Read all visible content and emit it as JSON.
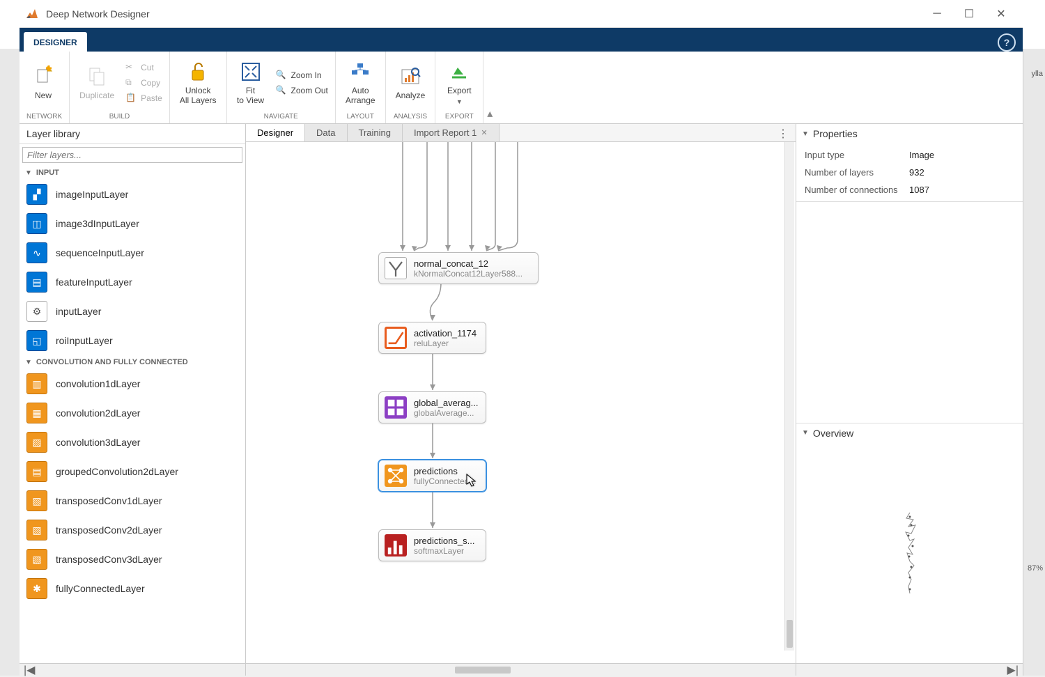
{
  "window": {
    "title": "Deep Network Designer"
  },
  "ribbonTab": "DESIGNER",
  "ribbon": {
    "network": {
      "label": "NETWORK",
      "new": "New"
    },
    "build": {
      "label": "BUILD",
      "duplicate": "Duplicate",
      "cut": "Cut",
      "copy": "Copy",
      "paste": "Paste"
    },
    "unlock": "Unlock\nAll Layers",
    "navigate": {
      "label": "NAVIGATE",
      "fit": "Fit\nto View",
      "zoomin": "Zoom In",
      "zoomout": "Zoom Out"
    },
    "layout": {
      "label": "LAYOUT",
      "auto": "Auto\nArrange"
    },
    "analysis": {
      "label": "ANALYSIS",
      "analyze": "Analyze"
    },
    "export": {
      "label": "EXPORT",
      "export": "Export"
    }
  },
  "sidebar": {
    "title": "Layer library",
    "filter_placeholder": "Filter layers...",
    "cat_input": "INPUT",
    "cat_conv": "CONVOLUTION AND FULLY CONNECTED",
    "layers_input": [
      "imageInputLayer",
      "image3dInputLayer",
      "sequenceInputLayer",
      "featureInputLayer",
      "inputLayer",
      "roiInputLayer"
    ],
    "layers_conv": [
      "convolution1dLayer",
      "convolution2dLayer",
      "convolution3dLayer",
      "groupedConvolution2dLayer",
      "transposedConv1dLayer",
      "transposedConv2dLayer",
      "transposedConv3dLayer",
      "fullyConnectedLayer"
    ]
  },
  "centerTabs": {
    "designer": "Designer",
    "data": "Data",
    "training": "Training",
    "import": "Import Report 1"
  },
  "nodes": {
    "n0": {
      "name": "normal_concat_12",
      "type": "kNormalConcat12Layer588..."
    },
    "n1": {
      "name": "activation_1174",
      "type": "reluLayer"
    },
    "n2": {
      "name": "global_averag...",
      "type": "globalAverage..."
    },
    "n3": {
      "name": "predictions",
      "type": "fullyConnected..."
    },
    "n4": {
      "name": "predictions_s...",
      "type": "softmaxLayer"
    }
  },
  "properties": {
    "title": "Properties",
    "inputType": {
      "label": "Input type",
      "value": "Image"
    },
    "numLayers": {
      "label": "Number of layers",
      "value": "932"
    },
    "numConn": {
      "label": "Number of connections",
      "value": "1087"
    }
  },
  "overview": {
    "title": "Overview"
  },
  "bgRight": {
    "user": "ylla",
    "zoom": "87%"
  }
}
